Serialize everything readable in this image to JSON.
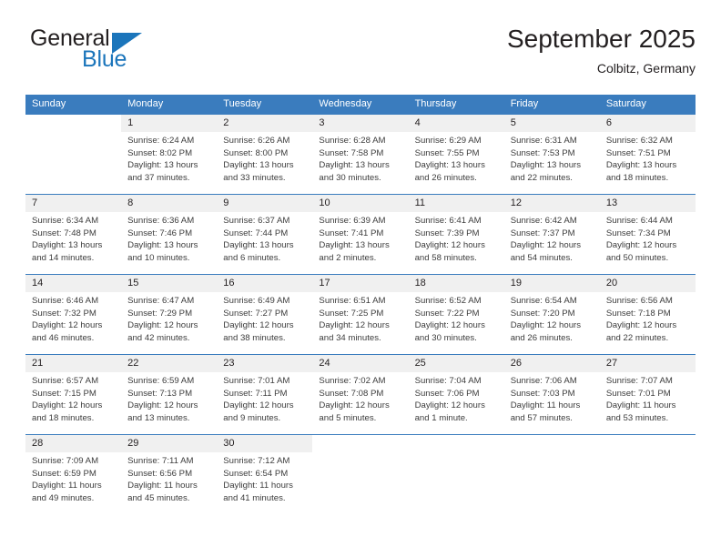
{
  "brand": {
    "name_part1": "General",
    "name_part2": "Blue",
    "triangle_color": "#1b75bb",
    "text_color": "#231f20"
  },
  "header": {
    "title": "September 2025",
    "location": "Colbitz, Germany"
  },
  "theme": {
    "header_row_bg": "#3a7cbe",
    "header_row_text": "#ffffff",
    "daynum_bg": "#f0f0f0",
    "cell_text": "#3c3c3c",
    "week_divider": "#3a7cbe"
  },
  "weekday_headers": [
    "Sunday",
    "Monday",
    "Tuesday",
    "Wednesday",
    "Thursday",
    "Friday",
    "Saturday"
  ],
  "weeks": [
    [
      {
        "day": "",
        "sunrise": "",
        "sunset": "",
        "daylight_line1": "",
        "daylight_line2": "",
        "empty": true
      },
      {
        "day": "1",
        "sunrise": "Sunrise: 6:24 AM",
        "sunset": "Sunset: 8:02 PM",
        "daylight_line1": "Daylight: 13 hours",
        "daylight_line2": "and 37 minutes."
      },
      {
        "day": "2",
        "sunrise": "Sunrise: 6:26 AM",
        "sunset": "Sunset: 8:00 PM",
        "daylight_line1": "Daylight: 13 hours",
        "daylight_line2": "and 33 minutes."
      },
      {
        "day": "3",
        "sunrise": "Sunrise: 6:28 AM",
        "sunset": "Sunset: 7:58 PM",
        "daylight_line1": "Daylight: 13 hours",
        "daylight_line2": "and 30 minutes."
      },
      {
        "day": "4",
        "sunrise": "Sunrise: 6:29 AM",
        "sunset": "Sunset: 7:55 PM",
        "daylight_line1": "Daylight: 13 hours",
        "daylight_line2": "and 26 minutes."
      },
      {
        "day": "5",
        "sunrise": "Sunrise: 6:31 AM",
        "sunset": "Sunset: 7:53 PM",
        "daylight_line1": "Daylight: 13 hours",
        "daylight_line2": "and 22 minutes."
      },
      {
        "day": "6",
        "sunrise": "Sunrise: 6:32 AM",
        "sunset": "Sunset: 7:51 PM",
        "daylight_line1": "Daylight: 13 hours",
        "daylight_line2": "and 18 minutes."
      }
    ],
    [
      {
        "day": "7",
        "sunrise": "Sunrise: 6:34 AM",
        "sunset": "Sunset: 7:48 PM",
        "daylight_line1": "Daylight: 13 hours",
        "daylight_line2": "and 14 minutes."
      },
      {
        "day": "8",
        "sunrise": "Sunrise: 6:36 AM",
        "sunset": "Sunset: 7:46 PM",
        "daylight_line1": "Daylight: 13 hours",
        "daylight_line2": "and 10 minutes."
      },
      {
        "day": "9",
        "sunrise": "Sunrise: 6:37 AM",
        "sunset": "Sunset: 7:44 PM",
        "daylight_line1": "Daylight: 13 hours",
        "daylight_line2": "and 6 minutes."
      },
      {
        "day": "10",
        "sunrise": "Sunrise: 6:39 AM",
        "sunset": "Sunset: 7:41 PM",
        "daylight_line1": "Daylight: 13 hours",
        "daylight_line2": "and 2 minutes."
      },
      {
        "day": "11",
        "sunrise": "Sunrise: 6:41 AM",
        "sunset": "Sunset: 7:39 PM",
        "daylight_line1": "Daylight: 12 hours",
        "daylight_line2": "and 58 minutes."
      },
      {
        "day": "12",
        "sunrise": "Sunrise: 6:42 AM",
        "sunset": "Sunset: 7:37 PM",
        "daylight_line1": "Daylight: 12 hours",
        "daylight_line2": "and 54 minutes."
      },
      {
        "day": "13",
        "sunrise": "Sunrise: 6:44 AM",
        "sunset": "Sunset: 7:34 PM",
        "daylight_line1": "Daylight: 12 hours",
        "daylight_line2": "and 50 minutes."
      }
    ],
    [
      {
        "day": "14",
        "sunrise": "Sunrise: 6:46 AM",
        "sunset": "Sunset: 7:32 PM",
        "daylight_line1": "Daylight: 12 hours",
        "daylight_line2": "and 46 minutes."
      },
      {
        "day": "15",
        "sunrise": "Sunrise: 6:47 AM",
        "sunset": "Sunset: 7:29 PM",
        "daylight_line1": "Daylight: 12 hours",
        "daylight_line2": "and 42 minutes."
      },
      {
        "day": "16",
        "sunrise": "Sunrise: 6:49 AM",
        "sunset": "Sunset: 7:27 PM",
        "daylight_line1": "Daylight: 12 hours",
        "daylight_line2": "and 38 minutes."
      },
      {
        "day": "17",
        "sunrise": "Sunrise: 6:51 AM",
        "sunset": "Sunset: 7:25 PM",
        "daylight_line1": "Daylight: 12 hours",
        "daylight_line2": "and 34 minutes."
      },
      {
        "day": "18",
        "sunrise": "Sunrise: 6:52 AM",
        "sunset": "Sunset: 7:22 PM",
        "daylight_line1": "Daylight: 12 hours",
        "daylight_line2": "and 30 minutes."
      },
      {
        "day": "19",
        "sunrise": "Sunrise: 6:54 AM",
        "sunset": "Sunset: 7:20 PM",
        "daylight_line1": "Daylight: 12 hours",
        "daylight_line2": "and 26 minutes."
      },
      {
        "day": "20",
        "sunrise": "Sunrise: 6:56 AM",
        "sunset": "Sunset: 7:18 PM",
        "daylight_line1": "Daylight: 12 hours",
        "daylight_line2": "and 22 minutes."
      }
    ],
    [
      {
        "day": "21",
        "sunrise": "Sunrise: 6:57 AM",
        "sunset": "Sunset: 7:15 PM",
        "daylight_line1": "Daylight: 12 hours",
        "daylight_line2": "and 18 minutes."
      },
      {
        "day": "22",
        "sunrise": "Sunrise: 6:59 AM",
        "sunset": "Sunset: 7:13 PM",
        "daylight_line1": "Daylight: 12 hours",
        "daylight_line2": "and 13 minutes."
      },
      {
        "day": "23",
        "sunrise": "Sunrise: 7:01 AM",
        "sunset": "Sunset: 7:11 PM",
        "daylight_line1": "Daylight: 12 hours",
        "daylight_line2": "and 9 minutes."
      },
      {
        "day": "24",
        "sunrise": "Sunrise: 7:02 AM",
        "sunset": "Sunset: 7:08 PM",
        "daylight_line1": "Daylight: 12 hours",
        "daylight_line2": "and 5 minutes."
      },
      {
        "day": "25",
        "sunrise": "Sunrise: 7:04 AM",
        "sunset": "Sunset: 7:06 PM",
        "daylight_line1": "Daylight: 12 hours",
        "daylight_line2": "and 1 minute."
      },
      {
        "day": "26",
        "sunrise": "Sunrise: 7:06 AM",
        "sunset": "Sunset: 7:03 PM",
        "daylight_line1": "Daylight: 11 hours",
        "daylight_line2": "and 57 minutes."
      },
      {
        "day": "27",
        "sunrise": "Sunrise: 7:07 AM",
        "sunset": "Sunset: 7:01 PM",
        "daylight_line1": "Daylight: 11 hours",
        "daylight_line2": "and 53 minutes."
      }
    ],
    [
      {
        "day": "28",
        "sunrise": "Sunrise: 7:09 AM",
        "sunset": "Sunset: 6:59 PM",
        "daylight_line1": "Daylight: 11 hours",
        "daylight_line2": "and 49 minutes."
      },
      {
        "day": "29",
        "sunrise": "Sunrise: 7:11 AM",
        "sunset": "Sunset: 6:56 PM",
        "daylight_line1": "Daylight: 11 hours",
        "daylight_line2": "and 45 minutes."
      },
      {
        "day": "30",
        "sunrise": "Sunrise: 7:12 AM",
        "sunset": "Sunset: 6:54 PM",
        "daylight_line1": "Daylight: 11 hours",
        "daylight_line2": "and 41 minutes."
      },
      {
        "day": "",
        "sunrise": "",
        "sunset": "",
        "daylight_line1": "",
        "daylight_line2": "",
        "empty": true
      },
      {
        "day": "",
        "sunrise": "",
        "sunset": "",
        "daylight_line1": "",
        "daylight_line2": "",
        "empty": true
      },
      {
        "day": "",
        "sunrise": "",
        "sunset": "",
        "daylight_line1": "",
        "daylight_line2": "",
        "empty": true
      },
      {
        "day": "",
        "sunrise": "",
        "sunset": "",
        "daylight_line1": "",
        "daylight_line2": "",
        "empty": true
      }
    ]
  ]
}
